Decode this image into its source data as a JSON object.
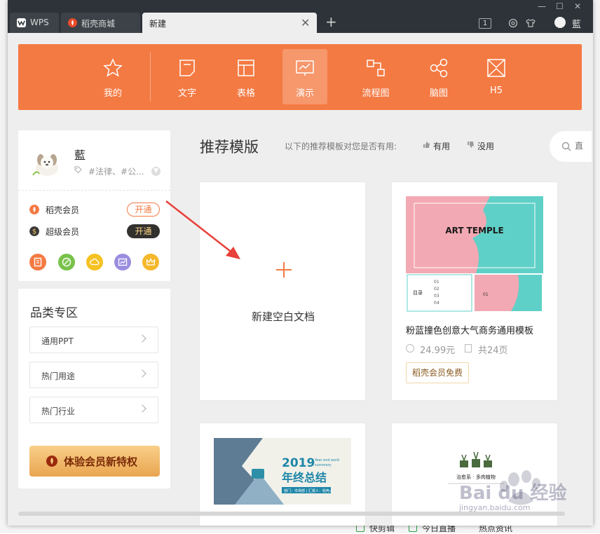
{
  "background": {
    "bottom_items": [
      "快剪辑",
      "今日直播",
      "热点资讯"
    ]
  },
  "titlebar": {
    "tabs": [
      {
        "label": "WPS"
      },
      {
        "label": "稻壳商城"
      },
      {
        "label": "新建"
      }
    ],
    "badge": "1",
    "user": "藍"
  },
  "categories": [
    {
      "label": "我的",
      "icon": "star-icon"
    },
    {
      "label": "文字",
      "icon": "doc-icon"
    },
    {
      "label": "表格",
      "icon": "table-icon"
    },
    {
      "label": "演示",
      "icon": "presentation-icon",
      "active": true
    },
    {
      "label": "流程图",
      "icon": "flowchart-icon"
    },
    {
      "label": "脑图",
      "icon": "mindmap-icon"
    },
    {
      "label": "H5",
      "icon": "h5-icon"
    }
  ],
  "profile": {
    "name": "藍",
    "tags": "#法律、#公...",
    "memberships": [
      {
        "label": "稻壳会员",
        "button": "开通"
      },
      {
        "label": "超级会员",
        "button": "开通"
      }
    ]
  },
  "category_zone": {
    "title": "品类专区",
    "items": [
      "通用PPT",
      "热门用途",
      "热门行业"
    ],
    "trial_button": "体验会员新特权"
  },
  "main": {
    "title": "推荐模版",
    "question": "以下的推荐模板对您是否有用:",
    "useful": "有用",
    "useless": "没用",
    "search_placeholder": "直"
  },
  "templates": {
    "blank_label": "新建空白文档",
    "cards": [
      {
        "thumb_title": "ART TEMPLE",
        "name": "粉蓝撞色创意大气商务通用模板",
        "price": "24.99元",
        "pages": "共24页",
        "badge": "稻壳会员免费",
        "thumb_nums": [
          "01",
          "02",
          "03",
          "04"
        ],
        "thumb_side": "目录",
        "thumb_mini": "01"
      },
      {
        "thumb_year": "2019",
        "thumb_en1": "Year end work",
        "thumb_en2": "summary",
        "thumb_cn": "年终总结",
        "thumb_sub": "部门：市场部 | 汇报人：稻壳人"
      },
      {
        "thumb_cn": "治愈系 · 多肉植物"
      }
    ]
  },
  "watermark": {
    "logo": "Bai du 经验",
    "url": "jingyan.baidu.com"
  },
  "colors": {
    "accent": "#f47a43",
    "titlebar": "#2d3338",
    "panel": "#eeeeee"
  }
}
